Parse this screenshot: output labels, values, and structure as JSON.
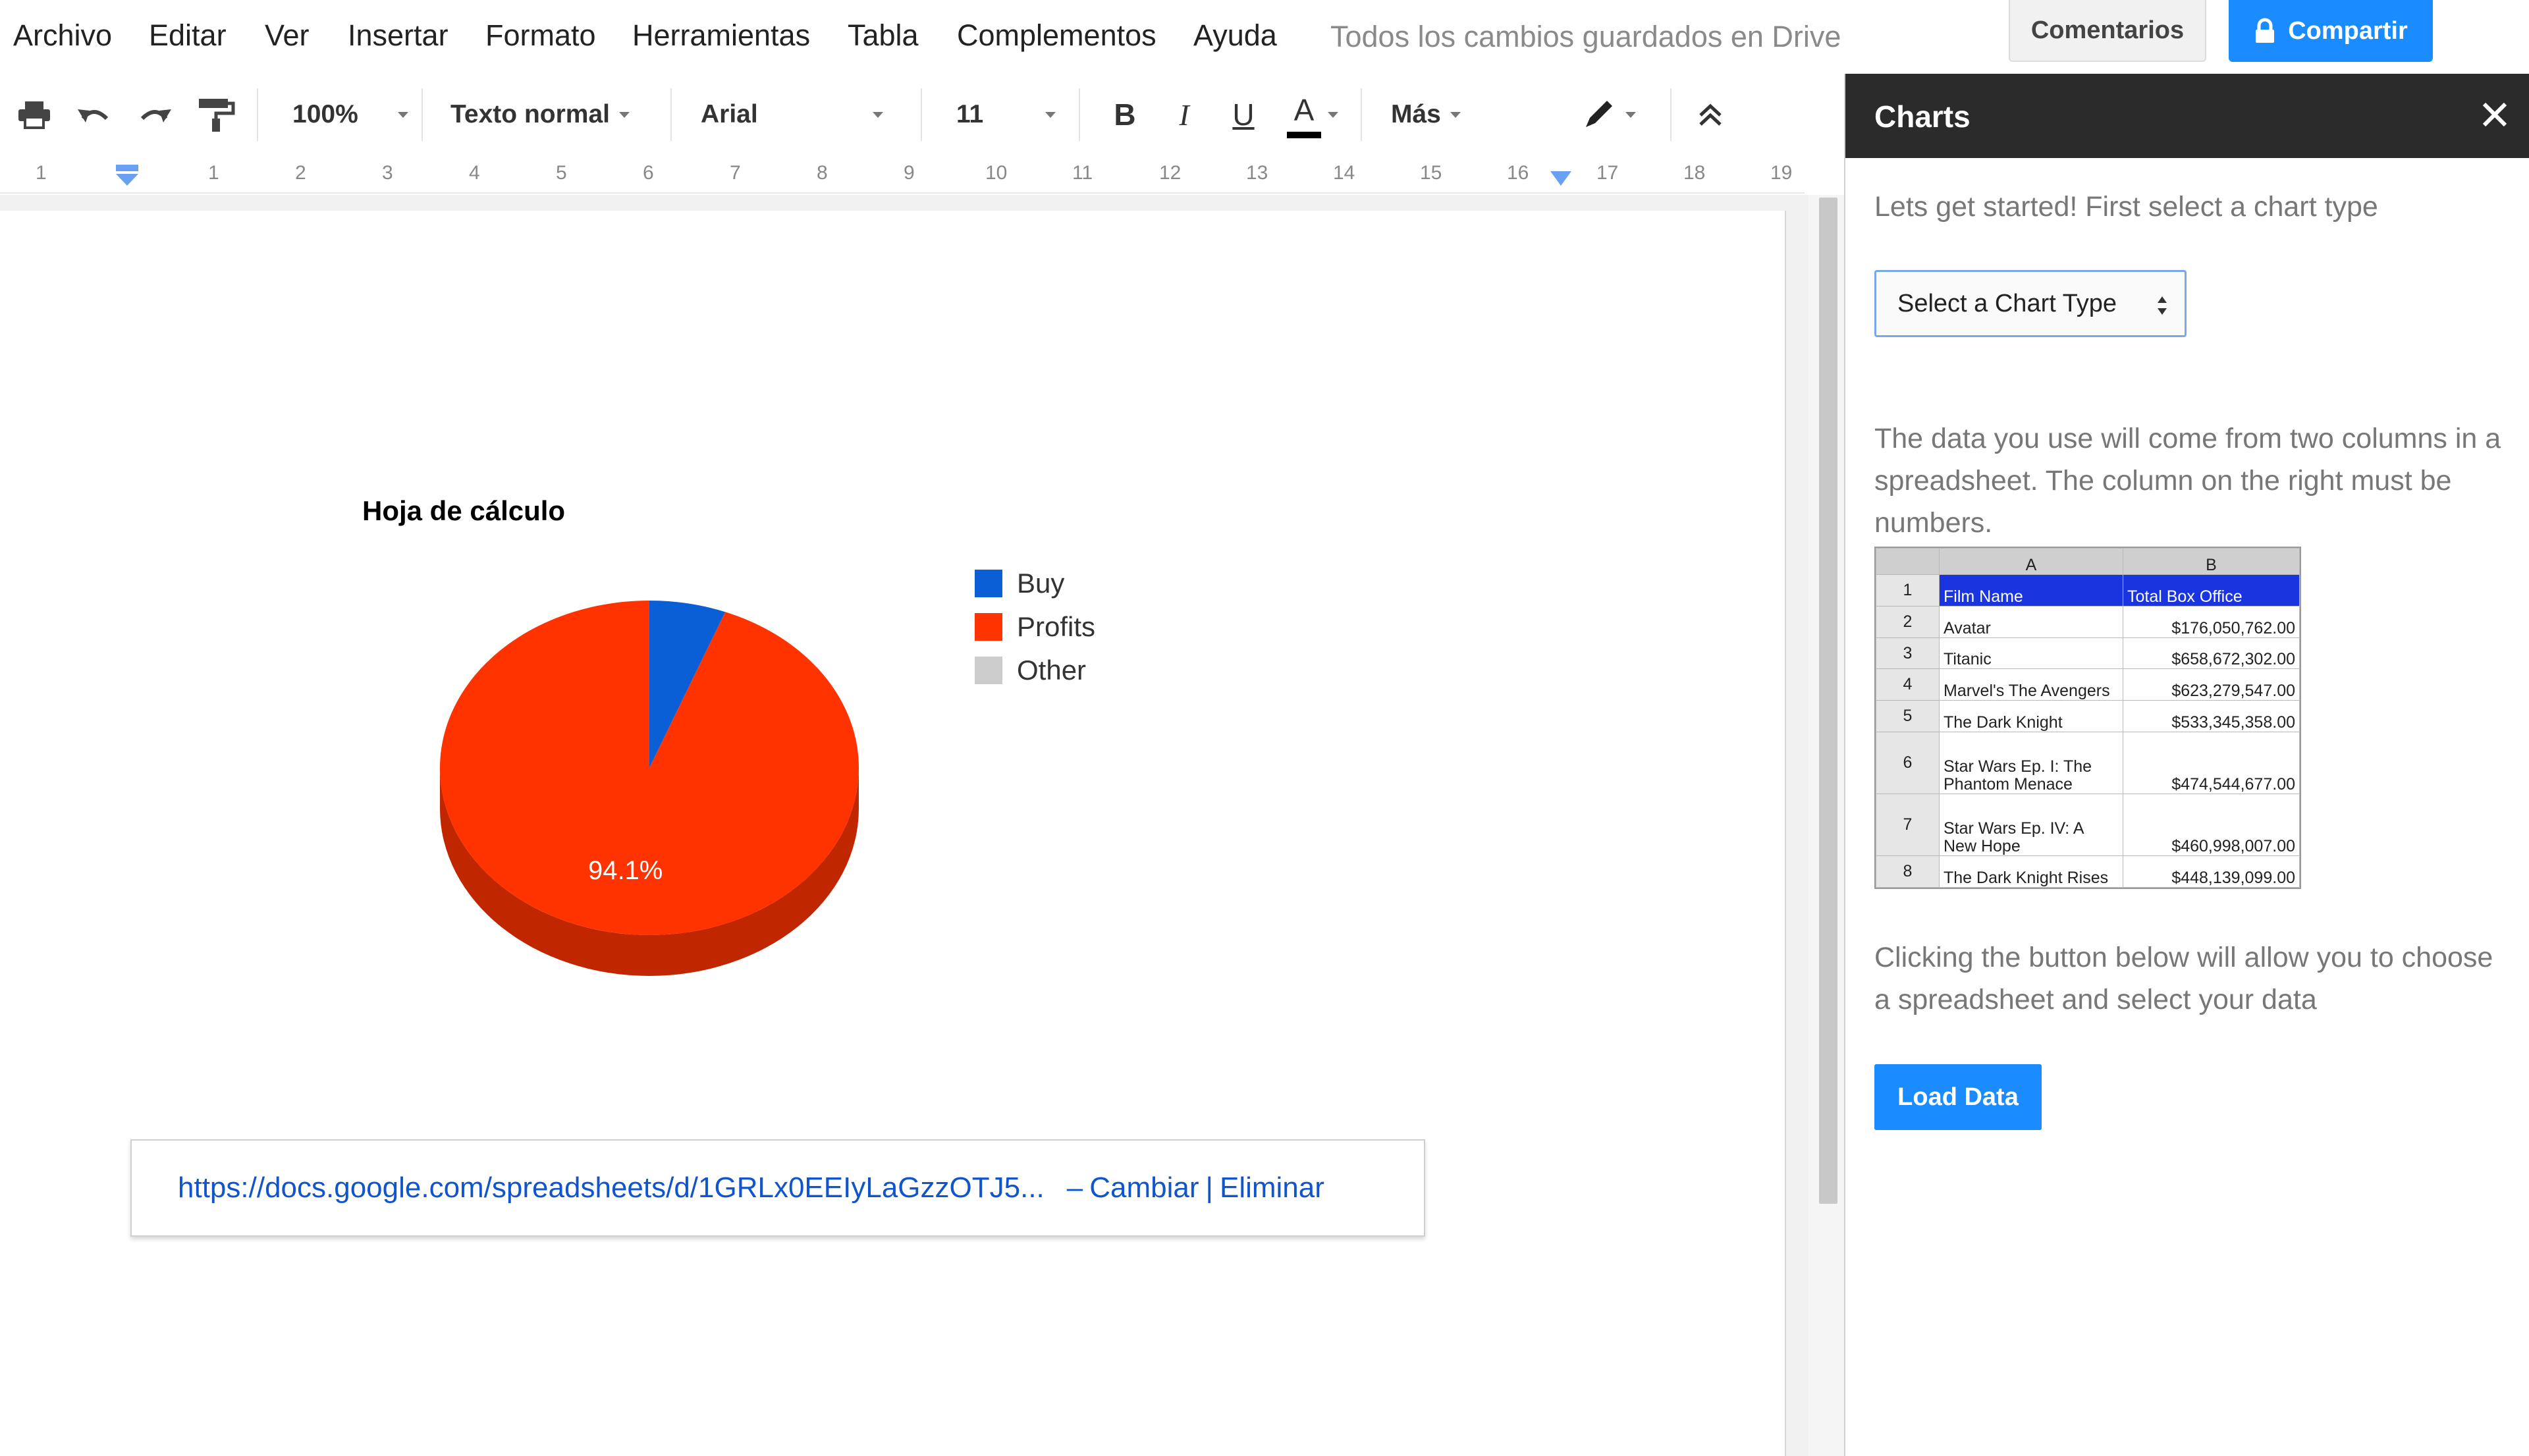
{
  "menu": {
    "items": [
      "Archivo",
      "Editar",
      "Ver",
      "Insertar",
      "Formato",
      "Herramientas",
      "Tabla",
      "Complementos",
      "Ayuda"
    ],
    "save_status": "Todos los cambios guardados en Drive",
    "comments_label": "Comentarios",
    "share_label": "Compartir"
  },
  "toolbar": {
    "zoom": "100%",
    "style": "Texto normal",
    "font": "Arial",
    "size": "11",
    "bold": "B",
    "italic": "I",
    "underline": "U",
    "text_color": "A",
    "more": "Más",
    "icons": [
      "print-icon",
      "undo-icon",
      "redo-icon",
      "paint-format-icon",
      "pen-icon",
      "collapse-icon"
    ]
  },
  "ruler": {
    "numbers": [
      "1",
      "1",
      "2",
      "3",
      "4",
      "5",
      "6",
      "7",
      "8",
      "9",
      "10",
      "11",
      "12",
      "13",
      "14",
      "15",
      "16",
      "17",
      "18",
      "19"
    ]
  },
  "document": {
    "link_url": "https://docs.google.com/spreadsheets/d/1GRLx0EEIyLaGzzOTJ5...",
    "link_dash": "–",
    "change_label": "Cambiar",
    "pipe": "|",
    "delete_label": "Eliminar"
  },
  "chart_data": {
    "type": "pie",
    "title": "Hoja de cálculo",
    "categories": [
      "Buy",
      "Profits",
      "Other"
    ],
    "values": [
      5.9,
      94.1,
      0
    ],
    "colors": [
      "#0b5fd6",
      "#ff3300",
      "#cccccc"
    ],
    "data_labels": [
      "",
      "94.1%",
      ""
    ],
    "legend_position": "right",
    "style": "3d"
  },
  "panel": {
    "title": "Charts",
    "intro": "Lets get started! First select a chart type",
    "select_label": "Select a Chart Type",
    "data_note": "The data you use will come from two columns in a spreadsheet. The column on the right must be numbers.",
    "load_note": "Clicking the button below will allow you to choose a spreadsheet and select your data",
    "load_button": "Load Data",
    "sample_sheet": {
      "col_headers": [
        "A",
        "B"
      ],
      "rows": [
        {
          "n": "1",
          "a": "Film Name",
          "b": "Total Box Office"
        },
        {
          "n": "2",
          "a": "Avatar",
          "b": "$176,050,762.00"
        },
        {
          "n": "3",
          "a": "Titanic",
          "b": "$658,672,302.00"
        },
        {
          "n": "4",
          "a": "Marvel's The Avengers",
          "b": "$623,279,547.00"
        },
        {
          "n": "5",
          "a": "The Dark Knight",
          "b": "$533,345,358.00"
        },
        {
          "n": "6",
          "a": "Star Wars Ep. I: The Phantom Menace",
          "b": "$474,544,677.00"
        },
        {
          "n": "7",
          "a": "Star Wars Ep. IV: A New Hope",
          "b": "$460,998,007.00"
        },
        {
          "n": "8",
          "a": "The Dark Knight Rises",
          "b": "$448,139,099.00"
        }
      ]
    }
  }
}
